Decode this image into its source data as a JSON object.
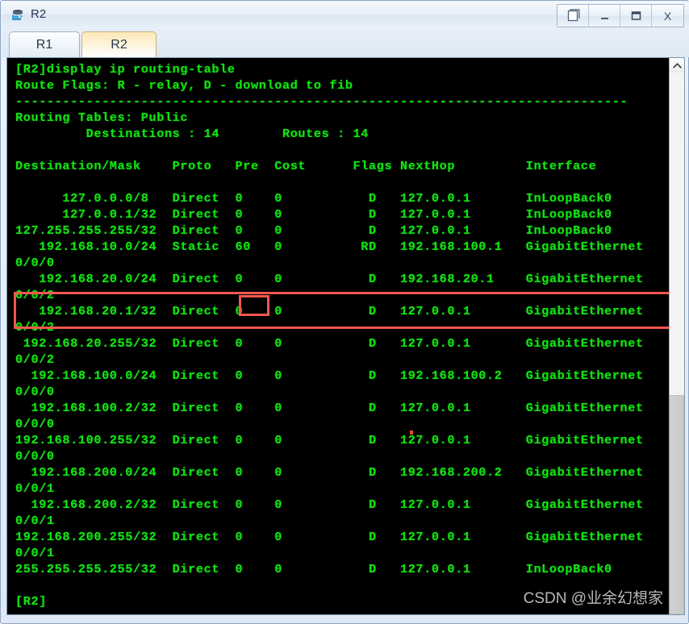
{
  "window": {
    "title": "R2",
    "app_icon": "router-icon",
    "buttons": [
      {
        "name": "restore-window-button",
        "icon": "restore-icon",
        "label": ""
      },
      {
        "name": "minimize-window-button",
        "icon": "minimize-icon",
        "label": ""
      },
      {
        "name": "maximize-window-button",
        "icon": "maximize-icon",
        "label": ""
      },
      {
        "name": "close-window-button",
        "icon": "close-icon",
        "label": "X"
      }
    ]
  },
  "tabs": [
    {
      "label": "R1",
      "active": false
    },
    {
      "label": "R2",
      "active": true
    }
  ],
  "terminal": {
    "prompt_command": "[R2]display ip routing-table",
    "route_flags_line": "Route Flags: R - relay, D - download to fib",
    "separator": "------------------------------------------------------------------------------",
    "routing_table_label": "Routing Tables: Public",
    "destinations_label": "Destinations : 14",
    "routes_label": "Routes : 14",
    "columns": [
      "Destination/Mask",
      "Proto",
      "Pre",
      "Cost",
      "Flags",
      "NextHop",
      "Interface"
    ],
    "final_prompt": "[R2]",
    "text_color": "#12e012",
    "background_color": "#000000",
    "full_text": "[R2]display ip routing-table\nRoute Flags: R - relay, D - download to fib\n------------------------------------------------------------------------------\nRouting Tables: Public\n         Destinations : 14        Routes : 14\n\nDestination/Mask    Proto   Pre  Cost      Flags NextHop         Interface\n\n      127.0.0.0/8   Direct  0    0           D   127.0.0.1       InLoopBack0\n      127.0.0.1/32  Direct  0    0           D   127.0.0.1       InLoopBack0\n127.255.255.255/32  Direct  0    0           D   127.0.0.1       InLoopBack0\n   192.168.10.0/24  Static  60   0          RD   192.168.100.1   GigabitEthernet\n0/0/0\n   192.168.20.0/24  Direct  0    0           D   192.168.20.1    GigabitEthernet\n0/0/2\n   192.168.20.1/32  Direct  0    0           D   127.0.0.1       GigabitEthernet\n0/0/2\n 192.168.20.255/32  Direct  0    0           D   127.0.0.1       GigabitEthernet\n0/0/2\n  192.168.100.0/24  Direct  0    0           D   192.168.100.2   GigabitEthernet\n0/0/0\n  192.168.100.2/32  Direct  0    0           D   127.0.0.1       GigabitEthernet\n0/0/0\n192.168.100.255/32  Direct  0    0           D   127.0.0.1       GigabitEthernet\n0/0/0\n  192.168.200.0/24  Direct  0    0           D   192.168.200.2   GigabitEthernet\n0/0/1\n  192.168.200.2/32  Direct  0    0           D   127.0.0.1       GigabitEthernet\n0/0/1\n192.168.200.255/32  Direct  0    0           D   127.0.0.1       GigabitEthernet\n0/0/1\n255.255.255.255/32  Direct  0    0           D   127.0.0.1       InLoopBack0\n\n[R2]",
    "routes": [
      {
        "destination": "127.0.0.0/8",
        "proto": "Direct",
        "pre": "0",
        "cost": "0",
        "flags": "D",
        "nexthop": "127.0.0.1",
        "interface": "InLoopBack0"
      },
      {
        "destination": "127.0.0.1/32",
        "proto": "Direct",
        "pre": "0",
        "cost": "0",
        "flags": "D",
        "nexthop": "127.0.0.1",
        "interface": "InLoopBack0"
      },
      {
        "destination": "127.255.255.255/32",
        "proto": "Direct",
        "pre": "0",
        "cost": "0",
        "flags": "D",
        "nexthop": "127.0.0.1",
        "interface": "InLoopBack0"
      },
      {
        "destination": "192.168.10.0/24",
        "proto": "Static",
        "pre": "60",
        "cost": "0",
        "flags": "RD",
        "nexthop": "192.168.100.1",
        "interface": "GigabitEthernet0/0/0"
      },
      {
        "destination": "192.168.20.0/24",
        "proto": "Direct",
        "pre": "0",
        "cost": "0",
        "flags": "D",
        "nexthop": "192.168.20.1",
        "interface": "GigabitEthernet0/0/2"
      },
      {
        "destination": "192.168.20.1/32",
        "proto": "Direct",
        "pre": "0",
        "cost": "0",
        "flags": "D",
        "nexthop": "127.0.0.1",
        "interface": "GigabitEthernet0/0/2"
      },
      {
        "destination": "192.168.20.255/32",
        "proto": "Direct",
        "pre": "0",
        "cost": "0",
        "flags": "D",
        "nexthop": "127.0.0.1",
        "interface": "GigabitEthernet0/0/2"
      },
      {
        "destination": "192.168.100.0/24",
        "proto": "Direct",
        "pre": "0",
        "cost": "0",
        "flags": "D",
        "nexthop": "192.168.100.2",
        "interface": "GigabitEthernet0/0/0"
      },
      {
        "destination": "192.168.100.2/32",
        "proto": "Direct",
        "pre": "0",
        "cost": "0",
        "flags": "D",
        "nexthop": "127.0.0.1",
        "interface": "GigabitEthernet0/0/0"
      },
      {
        "destination": "192.168.100.255/32",
        "proto": "Direct",
        "pre": "0",
        "cost": "0",
        "flags": "D",
        "nexthop": "127.0.0.1",
        "interface": "GigabitEthernet0/0/0"
      },
      {
        "destination": "192.168.200.0/24",
        "proto": "Direct",
        "pre": "0",
        "cost": "0",
        "flags": "D",
        "nexthop": "192.168.200.2",
        "interface": "GigabitEthernet0/0/1"
      },
      {
        "destination": "192.168.200.2/32",
        "proto": "Direct",
        "pre": "0",
        "cost": "0",
        "flags": "D",
        "nexthop": "127.0.0.1",
        "interface": "GigabitEthernet0/0/1"
      },
      {
        "destination": "192.168.200.255/32",
        "proto": "Direct",
        "pre": "0",
        "cost": "0",
        "flags": "D",
        "nexthop": "127.0.0.1",
        "interface": "GigabitEthernet0/0/1"
      },
      {
        "destination": "255.255.255.255/32",
        "proto": "Direct",
        "pre": "0",
        "cost": "0",
        "flags": "D",
        "nexthop": "127.0.0.1",
        "interface": "InLoopBack0"
      }
    ]
  },
  "annotations": {
    "highlight_color": "#f2574f",
    "highlighted_route": "192.168.10.0/24",
    "highlighted_value": "60"
  },
  "scrollbar": {
    "up_arrow": "chevron-up-icon"
  },
  "watermark": "CSDN @业余幻想家"
}
